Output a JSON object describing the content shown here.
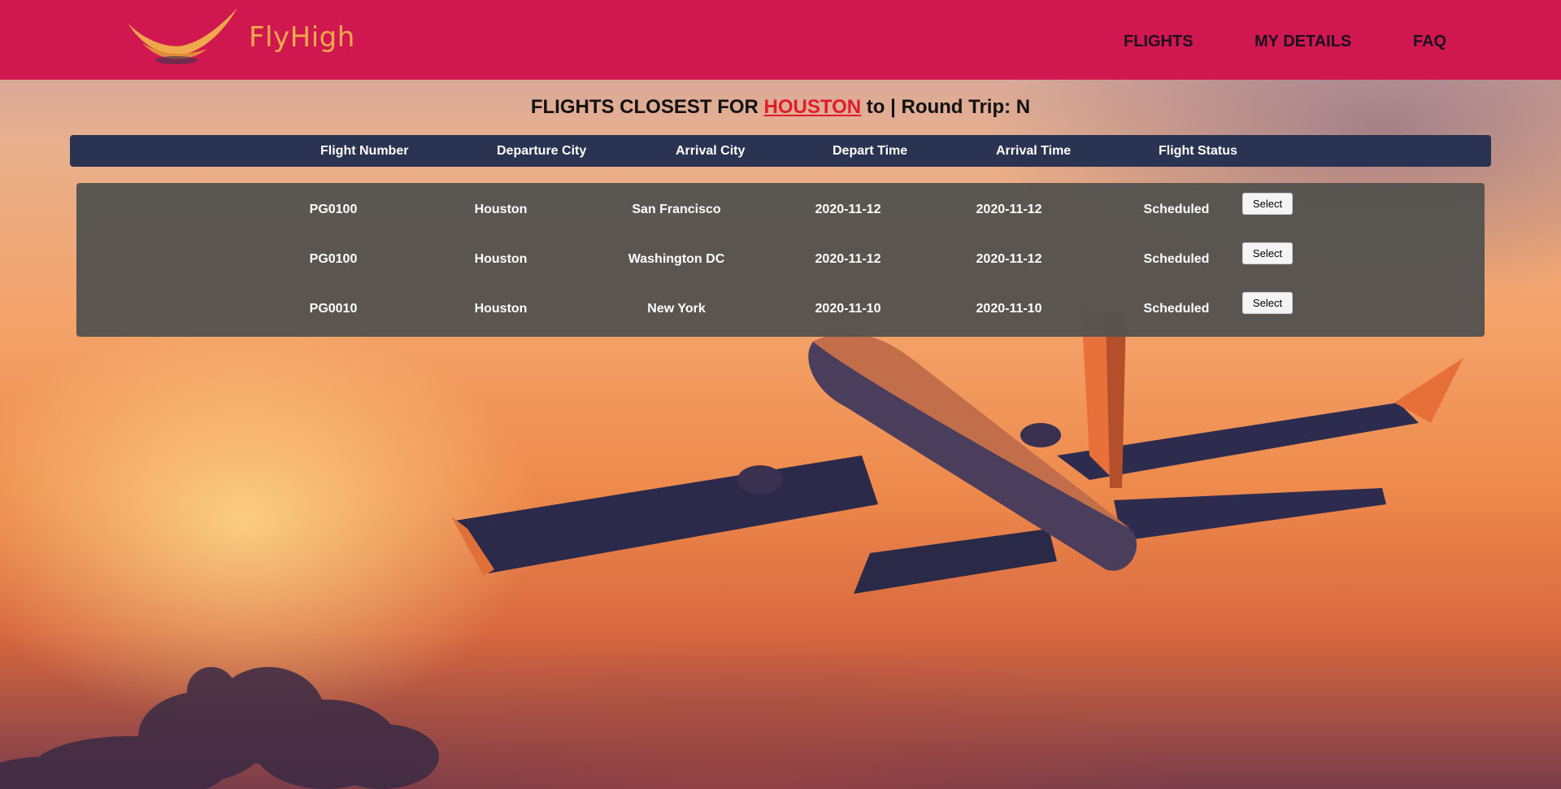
{
  "brand": {
    "name_part1": "Fly",
    "name_part2": "High",
    "logo_color": "#f0a94a"
  },
  "header": {
    "background": "#d1174f"
  },
  "nav": {
    "items": [
      {
        "label": "FLIGHTS"
      },
      {
        "label": "MY DETAILS"
      },
      {
        "label": "FAQ"
      }
    ]
  },
  "search": {
    "prefix": "FLIGHTS CLOSEST FOR",
    "origin": "HOUSTON",
    "suffix": "to | Round Trip: N"
  },
  "table": {
    "columns": [
      "Flight Number",
      "Departure City",
      "Arrival City",
      "Depart Time",
      "Arrival Time",
      "Flight Status"
    ],
    "rows": [
      {
        "flight_number": "PG0100",
        "departure_city": "Houston",
        "arrival_city": "San Francisco",
        "depart_time": "2020-11-12",
        "arrival_time": "2020-11-12",
        "status": "Scheduled",
        "action": "Select"
      },
      {
        "flight_number": "PG0100",
        "departure_city": "Houston",
        "arrival_city": "Washington DC",
        "depart_time": "2020-11-12",
        "arrival_time": "2020-11-12",
        "status": "Scheduled",
        "action": "Select"
      },
      {
        "flight_number": "PG0010",
        "departure_city": "Houston",
        "arrival_city": "New York",
        "depart_time": "2020-11-10",
        "arrival_time": "2020-11-10",
        "status": "Scheduled",
        "action": "Select"
      }
    ]
  },
  "colors": {
    "table_header": "#2b3353",
    "table_body": "#55534f",
    "highlight": "#e01b2a"
  }
}
